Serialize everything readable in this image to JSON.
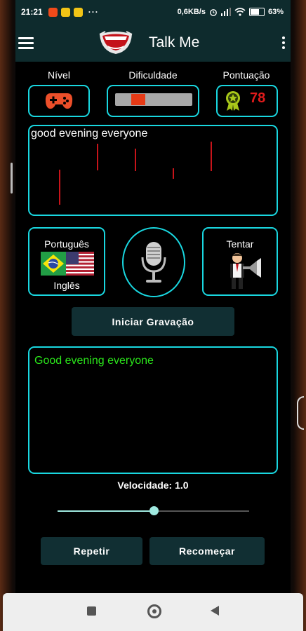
{
  "status_bar": {
    "time": "21:21",
    "dots": "···",
    "network_speed": "0,6KB/s",
    "battery": "63"
  },
  "app_bar": {
    "title": "Talk Me"
  },
  "stats": {
    "level_label": "Nível",
    "difficulty_label": "Dificuldade",
    "score_label": "Pontuação",
    "score_value": "78",
    "difficulty_level": 0.22
  },
  "target_phrase": "good evening everyone",
  "languages": {
    "from": "Português",
    "to": "Inglês"
  },
  "try_label": "Tentar",
  "record_button": "Iniciar Gravação",
  "recognized_text": "Good evening everyone",
  "speed": {
    "label": "Velocidade: 1.0",
    "value": 0.5
  },
  "buttons": {
    "repeat": "Repetir",
    "restart": "Recomeçar"
  },
  "colors": {
    "accent": "#19d7e0",
    "score": "#e01b1b",
    "recognized": "#2be71b",
    "appbar": "#0e2b2d"
  }
}
